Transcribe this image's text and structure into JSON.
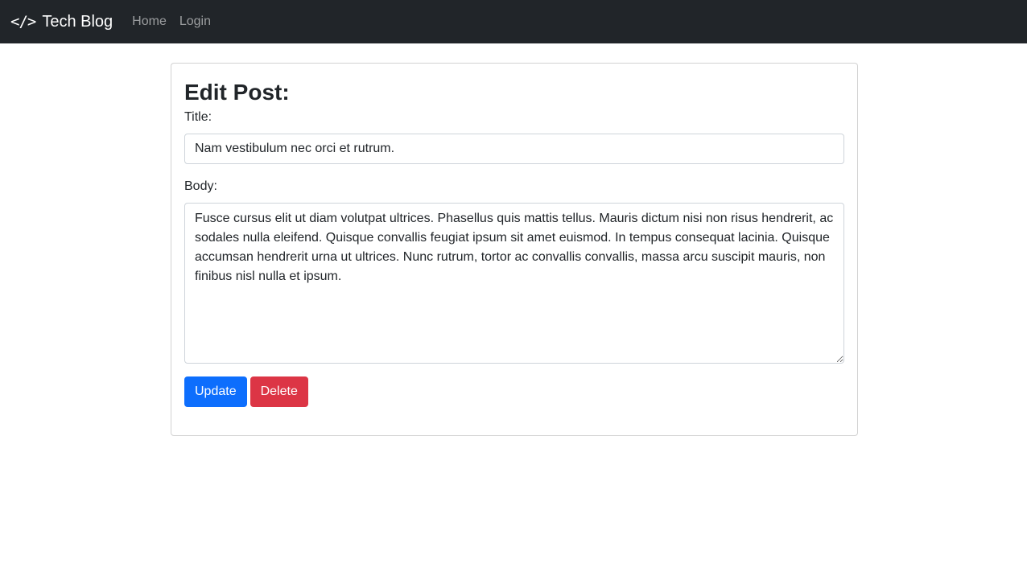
{
  "navbar": {
    "brand_icon": "</>",
    "brand_text": "Tech Blog",
    "links": [
      "Home",
      "Login"
    ]
  },
  "form": {
    "heading": "Edit Post:",
    "title_label": "Title:",
    "title_value": "Nam vestibulum nec orci et rutrum.",
    "body_label": "Body:",
    "body_value": "Fusce cursus elit ut diam volutpat ultrices. Phasellus quis mattis tellus. Mauris dictum nisi non risus hendrerit, ac sodales nulla eleifend. Quisque convallis feugiat ipsum sit amet euismod. In tempus consequat lacinia. Quisque accumsan hendrerit urna ut ultrices. Nunc rutrum, tortor ac convallis convallis, massa arcu suscipit mauris, non finibus nisl nulla et ipsum.",
    "update_label": "Update",
    "delete_label": "Delete"
  },
  "colors": {
    "navbar_bg": "#212529",
    "update_btn": "#0d6efd",
    "delete_btn": "#dc3545"
  }
}
